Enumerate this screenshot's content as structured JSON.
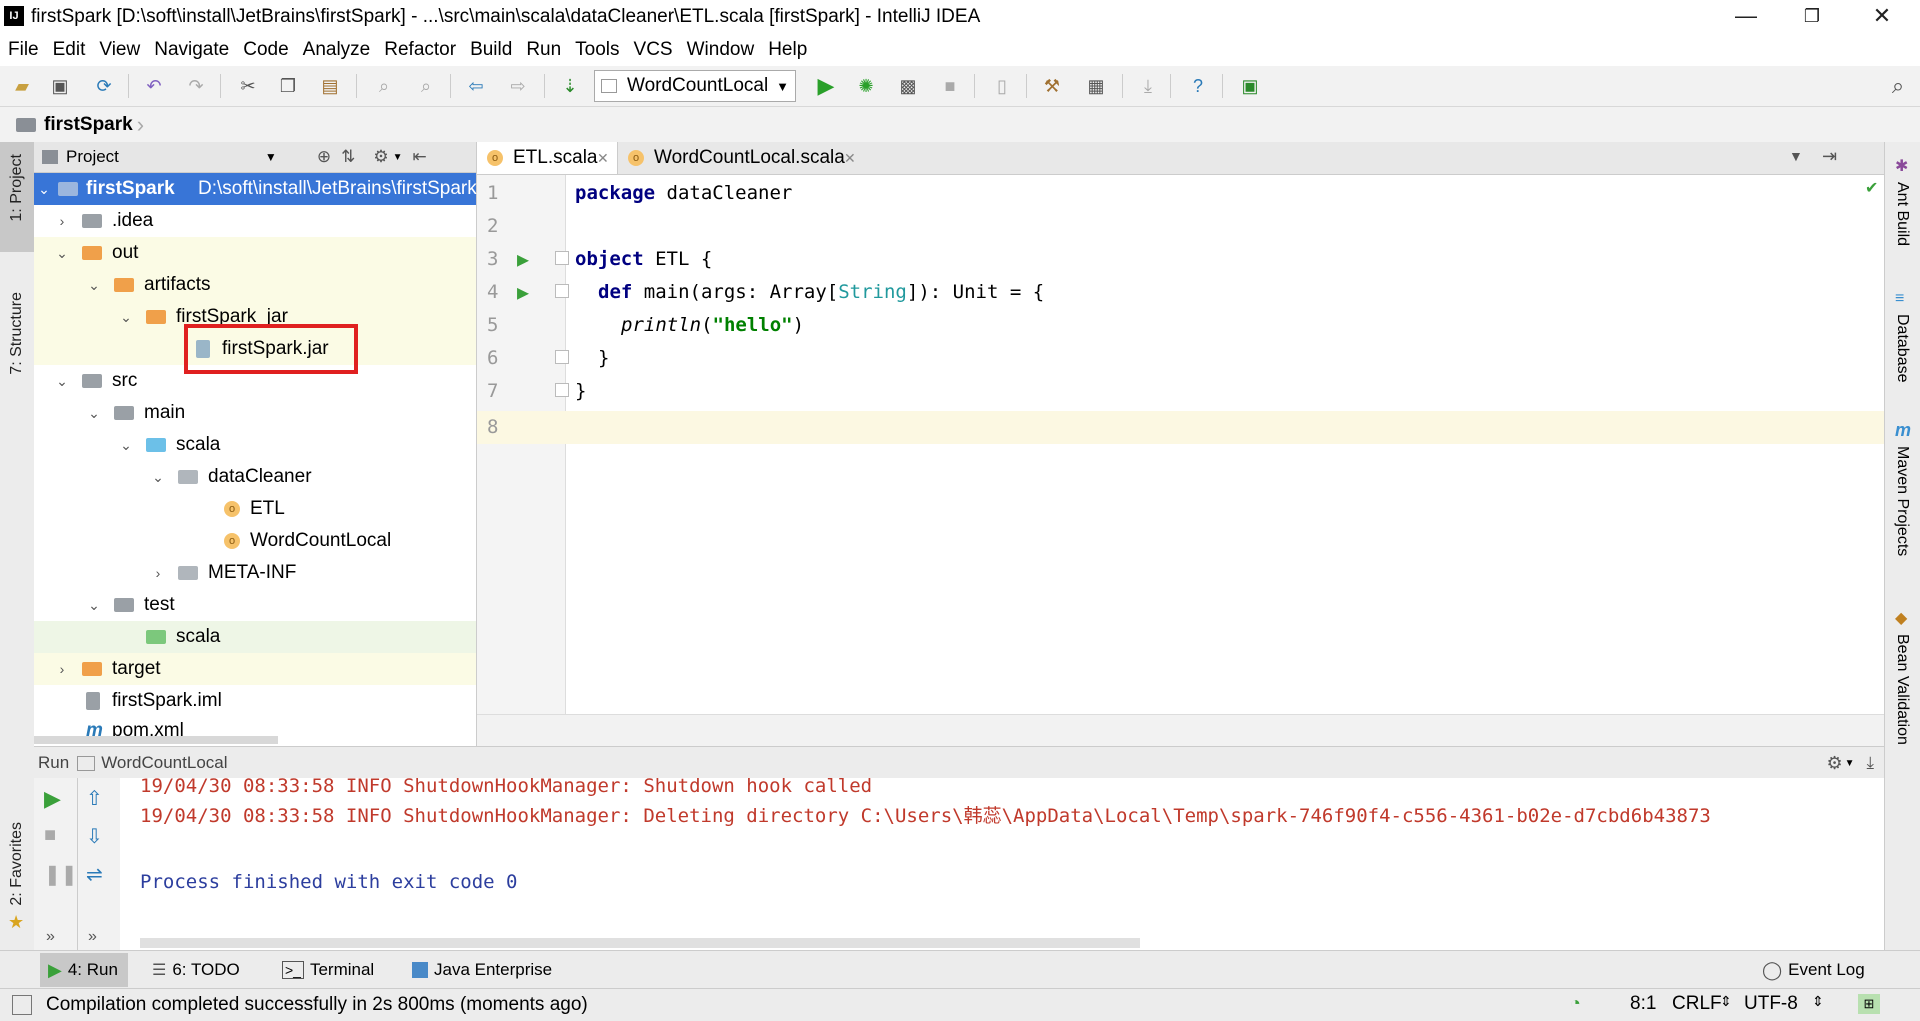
{
  "window": {
    "title": "firstSpark [D:\\soft\\install\\JetBrains\\firstSpark] - ...\\src\\main\\scala\\dataCleaner\\ETL.scala [firstSpark] - IntelliJ IDEA",
    "minimize": "—",
    "restore": "❐",
    "close": "✕",
    "logo": "IJ"
  },
  "menu": [
    "File",
    "Edit",
    "View",
    "Navigate",
    "Code",
    "Analyze",
    "Refactor",
    "Build",
    "Run",
    "Tools",
    "VCS",
    "Window",
    "Help"
  ],
  "toolbar": {
    "run_config": "WordCountLocal"
  },
  "breadcrumb": {
    "project": "firstSpark"
  },
  "left_strip": {
    "project_tab": "1: Project",
    "structure_tab": "7: Structure",
    "favorites_tab": "2: Favorites"
  },
  "project_panel": {
    "header": "Project",
    "root_name": "firstSpark",
    "root_path": "D:\\soft\\install\\JetBrains\\firstSpark",
    "items": [
      ".idea",
      "out",
      "artifacts",
      "firstSpark_jar",
      "firstSpark.jar",
      "src",
      "main",
      "scala",
      "dataCleaner",
      "ETL",
      "WordCountLocal",
      "META-INF",
      "test",
      "scala",
      "target",
      "firstSpark.iml",
      "pom.xml"
    ]
  },
  "editor": {
    "tabs": [
      "ETL.scala",
      "WordCountLocal.scala"
    ],
    "line_numbers": [
      "1",
      "2",
      "3",
      "4",
      "5",
      "6",
      "7",
      "8"
    ],
    "code": {
      "l1_kw": "package",
      "l1_rest": " dataCleaner",
      "l3_kw": "object",
      "l3_rest": " ETL {",
      "l4_kw": "def",
      "l4_a": " main(args: Array[",
      "l4_type": "String",
      "l4_b": "]): Unit = {",
      "l5_fn": "println",
      "l5_open": "(",
      "l5_str": "\"hello\"",
      "l5_close": ")",
      "l6": "}",
      "l7": "}"
    }
  },
  "right_strip": [
    "Ant Build",
    "Database",
    "Maven Projects",
    "Bean Validation"
  ],
  "run_panel": {
    "label": "Run",
    "config": "WordCountLocal",
    "console": [
      "19/04/30 08:33:58 INFO ShutdownHookManager: Shutdown hook called",
      "19/04/30 08:33:58 INFO ShutdownHookManager: Deleting directory C:\\Users\\韩蕊\\AppData\\Local\\Temp\\spark-746f90f4-c556-4361-b02e-d7cbd6b43873",
      "Process finished with exit code 0"
    ]
  },
  "bottom_tools": {
    "run": "4: Run",
    "todo": "6: TODO",
    "terminal": "Terminal",
    "java_ee": "Java Enterprise",
    "event_log": "Event Log"
  },
  "status": {
    "message": "Compilation completed successfully in 2s 800ms (moments ago)",
    "position": "8:1",
    "line_sep": "CRLF",
    "encoding": "UTF-8"
  },
  "colors": {
    "selection": "#3875d7",
    "output_red": "#c0392b",
    "output_blue": "#2c3e9e",
    "highlight_box": "#e02020",
    "modified_yellow": "#fbfbe5"
  }
}
